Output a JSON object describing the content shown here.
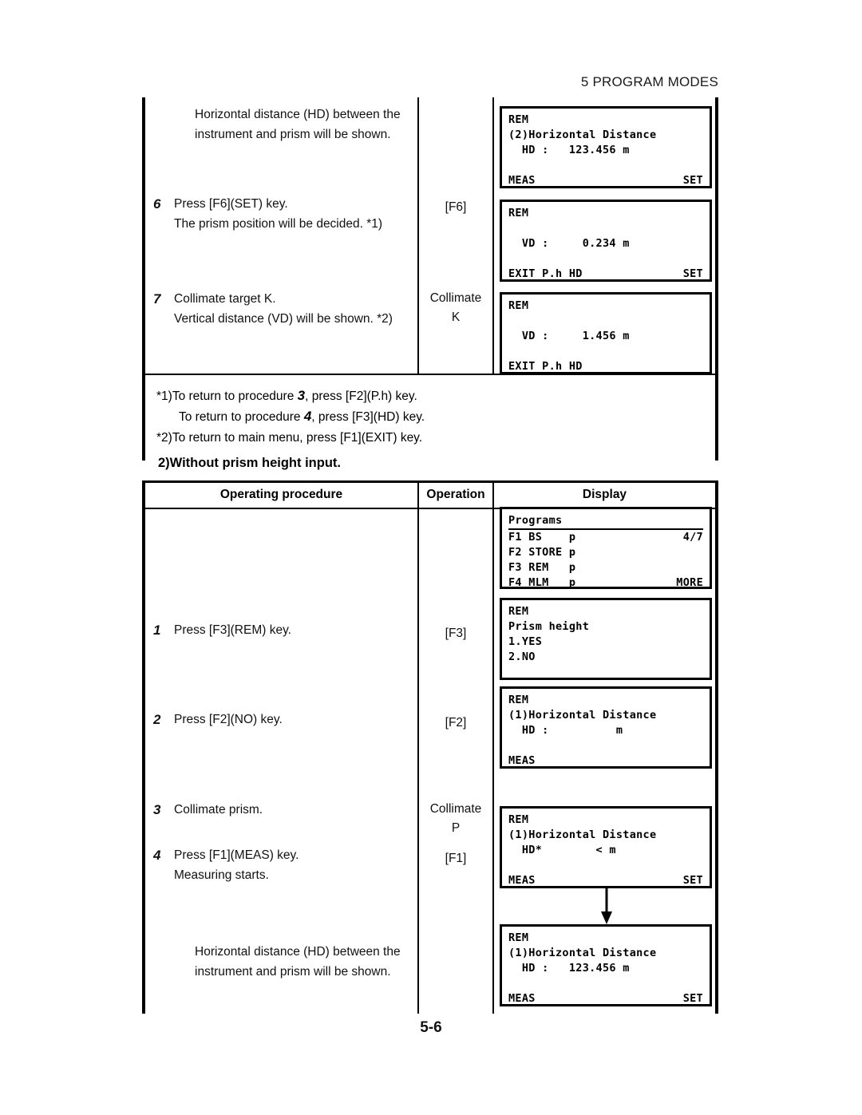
{
  "page": {
    "running_head": "5 PROGRAM MODES",
    "page_number": "5-6"
  },
  "table1": {
    "steps": [
      {
        "number": "",
        "text": "Horizontal distance (HD) between the\ninstrument and prism will be shown."
      },
      {
        "number": "6",
        "text": "Press [F6](SET) key.\nThe prism position will be decided. *1)"
      },
      {
        "number": "7",
        "text": "Collimate target K.\nVertical distance (VD) will be shown. *2)"
      }
    ],
    "operations": [
      {
        "label": "[F6]"
      },
      {
        "label": "Collimate\nK"
      }
    ],
    "footnotes": [
      {
        "prefix": "*1)",
        "before": "To return to procedure ",
        "num": "3",
        "after": ", press [F2](P.h) key."
      },
      {
        "prefix": "",
        "before": "To return to procedure ",
        "num": "4",
        "after": ", press [F3](HD) key."
      },
      {
        "prefix": "*2)",
        "before": "To return to main menu, press [F1](EXIT) key.",
        "num": "",
        "after": ""
      }
    ],
    "displays": [
      {
        "name": "rem-horizontal-distance-123",
        "lines": [
          {
            "type": "text",
            "value": "REM"
          },
          {
            "type": "text",
            "value": "(2)Horizontal Distance"
          },
          {
            "type": "text",
            "value": "  HD :   123.456 m"
          },
          {
            "type": "blank",
            "value": ""
          },
          {
            "type": "split",
            "left": "MEAS",
            "right": "SET"
          }
        ]
      },
      {
        "name": "rem-vertical-distance-0234",
        "lines": [
          {
            "type": "text",
            "value": "REM"
          },
          {
            "type": "blank",
            "value": ""
          },
          {
            "type": "text",
            "value": "  VD :     0.234 m"
          },
          {
            "type": "blank",
            "value": ""
          },
          {
            "type": "split",
            "left": "EXIT P.h HD",
            "right": "SET"
          }
        ]
      },
      {
        "name": "rem-vertical-distance-1456",
        "lines": [
          {
            "type": "text",
            "value": "REM"
          },
          {
            "type": "blank",
            "value": ""
          },
          {
            "type": "text",
            "value": "  VD :     1.456 m"
          },
          {
            "type": "blank",
            "value": ""
          },
          {
            "type": "split",
            "left": "EXIT P.h HD",
            "right": ""
          }
        ]
      }
    ]
  },
  "section2": {
    "caption": "2)Without prism height input."
  },
  "table2": {
    "headers": {
      "procedure": "Operating procedure",
      "operation": "Operation",
      "display": "Display"
    },
    "steps": [
      {
        "number": "1",
        "text": "Press [F3](REM) key."
      },
      {
        "number": "2",
        "text": "Press [F2](NO) key."
      },
      {
        "number": "3",
        "text": "Collimate prism."
      },
      {
        "number": "4",
        "text": "Press [F1](MEAS) key.\nMeasuring starts."
      },
      {
        "number": "",
        "text": "Horizontal distance (HD) between the\ninstrument and prism will be shown."
      }
    ],
    "operations": [
      {
        "label": "[F3]"
      },
      {
        "label": "[F2]"
      },
      {
        "label": "Collimate\nP"
      },
      {
        "label": "[F1]"
      }
    ],
    "displays": [
      {
        "name": "programs-menu",
        "lines": [
          {
            "type": "underline",
            "value": "Programs"
          },
          {
            "type": "split",
            "left": "F1 BS    p",
            "right": "4/7"
          },
          {
            "type": "text",
            "value": "F2 STORE p"
          },
          {
            "type": "text",
            "value": "F3 REM   p"
          },
          {
            "type": "split",
            "left": "F4 MLM   p",
            "right": "MORE"
          }
        ]
      },
      {
        "name": "rem-prism-height-prompt",
        "lines": [
          {
            "type": "text",
            "value": "REM"
          },
          {
            "type": "text",
            "value": "Prism height"
          },
          {
            "type": "text",
            "value": "1.YES"
          },
          {
            "type": "text",
            "value": "2.NO"
          },
          {
            "type": "blank",
            "value": ""
          }
        ]
      },
      {
        "name": "rem-horizontal-distance-empty",
        "lines": [
          {
            "type": "text",
            "value": "REM"
          },
          {
            "type": "text",
            "value": "(1)Horizontal Distance"
          },
          {
            "type": "text",
            "value": "  HD :          m"
          },
          {
            "type": "blank",
            "value": ""
          },
          {
            "type": "split",
            "left": "MEAS",
            "right": ""
          }
        ]
      },
      {
        "name": "rem-horizontal-distance-measuring",
        "lines": [
          {
            "type": "text",
            "value": "REM"
          },
          {
            "type": "text",
            "value": "(1)Horizontal Distance"
          },
          {
            "type": "text",
            "value": "  HD*        < m"
          },
          {
            "type": "blank",
            "value": ""
          },
          {
            "type": "split",
            "left": "MEAS",
            "right": "SET"
          }
        ]
      },
      {
        "name": "rem-horizontal-distance-result",
        "lines": [
          {
            "type": "text",
            "value": "REM"
          },
          {
            "type": "text",
            "value": "(1)Horizontal Distance"
          },
          {
            "type": "text",
            "value": "  HD :   123.456 m"
          },
          {
            "type": "blank",
            "value": ""
          },
          {
            "type": "split",
            "left": "MEAS",
            "right": "SET"
          }
        ]
      }
    ],
    "flow_arrow": "down-arrow-icon"
  }
}
